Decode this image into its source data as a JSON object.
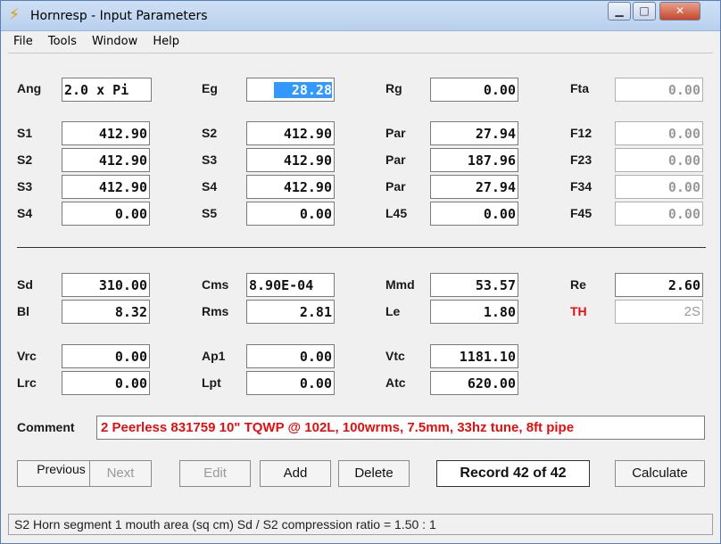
{
  "window": {
    "title": "Hornresp - Input Parameters",
    "minimize_glyph": "▁",
    "maximize_glyph": "□",
    "close_glyph": "✕"
  },
  "menu": [
    "File",
    "Tools",
    "Window",
    "Help"
  ],
  "rows": {
    "ang": {
      "label": "Ang",
      "value": "2.0 x Pi"
    },
    "eg": {
      "label": "Eg",
      "value": "28.28"
    },
    "rg": {
      "label": "Rg",
      "value": "0.00"
    },
    "fta": {
      "label": "Fta",
      "value": "0.00"
    },
    "col1": [
      {
        "label": "S1",
        "value": "412.90"
      },
      {
        "label": "S2",
        "value": "412.90"
      },
      {
        "label": "S3",
        "value": "412.90"
      },
      {
        "label": "S4",
        "value": "0.00"
      }
    ],
    "col2": [
      {
        "label": "S2",
        "value": "412.90"
      },
      {
        "label": "S3",
        "value": "412.90"
      },
      {
        "label": "S4",
        "value": "412.90"
      },
      {
        "label": "S5",
        "value": "0.00"
      }
    ],
    "col3": [
      {
        "label": "Par",
        "value": "27.94"
      },
      {
        "label": "Par",
        "value": "187.96"
      },
      {
        "label": "Par",
        "value": "27.94"
      },
      {
        "label": "L45",
        "value": "0.00"
      }
    ],
    "col4": [
      {
        "label": "F12",
        "value": "0.00"
      },
      {
        "label": "F23",
        "value": "0.00"
      },
      {
        "label": "F34",
        "value": "0.00"
      },
      {
        "label": "F45",
        "value": "0.00"
      }
    ],
    "driver": [
      {
        "label": "Sd",
        "value": "310.00"
      },
      {
        "label": "Bl",
        "value": "8.32"
      },
      {
        "label": "Cms",
        "value": "8.90E-04"
      },
      {
        "label": "Rms",
        "value": "2.81"
      },
      {
        "label": "Mmd",
        "value": "53.57"
      },
      {
        "label": "Le",
        "value": "1.80"
      },
      {
        "label": "Re",
        "value": "2.60"
      },
      {
        "label": "TH",
        "value": "2S"
      }
    ],
    "chamber": [
      {
        "label": "Vrc",
        "value": "0.00"
      },
      {
        "label": "Lrc",
        "value": "0.00"
      },
      {
        "label": "Ap1",
        "value": "0.00"
      },
      {
        "label": "Lpt",
        "value": "0.00"
      },
      {
        "label": "Vtc",
        "value": "1181.10"
      },
      {
        "label": "Atc",
        "value": "620.00"
      }
    ]
  },
  "comment": {
    "label": "Comment",
    "value": "2 Peerless 831759 10\" TQWP @ 102L, 100wrms, 7.5mm, 33hz tune, 8ft pipe"
  },
  "buttons": {
    "previous": "Previous",
    "next": "Next",
    "edit": "Edit",
    "add": "Add",
    "delete": "Delete",
    "record": "Record 42 of 42",
    "calculate": "Calculate"
  },
  "status": "S2  Horn segment 1 mouth area  (sq cm)  Sd / S2 compression ratio = 1.50 : 1"
}
